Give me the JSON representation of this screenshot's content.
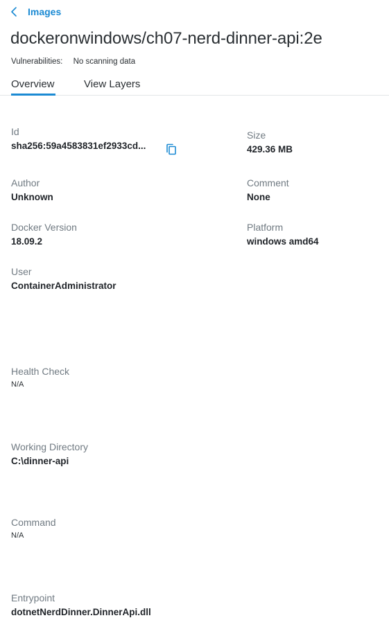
{
  "nav": {
    "back_label": "Images"
  },
  "header": {
    "title": "dockeronwindows/ch07-nerd-dinner-api:2e",
    "vulnerabilities_label": "Vulnerabilities:",
    "vulnerabilities_value": "No scanning data"
  },
  "tabs": [
    {
      "label": "Overview",
      "active": true
    },
    {
      "label": "View Layers",
      "active": false
    }
  ],
  "details": {
    "id": {
      "label": "Id",
      "value": "sha256:59a4583831ef2933cd..."
    },
    "size": {
      "label": "Size",
      "value": "429.36 MB"
    },
    "author": {
      "label": "Author",
      "value": "Unknown"
    },
    "comment": {
      "label": "Comment",
      "value": "None"
    },
    "docker_version": {
      "label": "Docker Version",
      "value": "18.09.2"
    },
    "platform": {
      "label": "Platform",
      "value": "windows amd64"
    },
    "user": {
      "label": "User",
      "value": "ContainerAdministrator"
    },
    "health_check": {
      "label": "Health Check",
      "value": "N/A"
    },
    "working_directory": {
      "label": "Working Directory",
      "value": "C:\\dinner-api"
    },
    "command": {
      "label": "Command",
      "value": "N/A"
    },
    "entrypoint": {
      "label": "Entrypoint",
      "value": "dotnetNerdDinner.DinnerApi.dll"
    }
  },
  "icons": {
    "back": "chevron-left-icon",
    "copy": "copy-icon"
  },
  "colors": {
    "accent": "#1b8ad3",
    "label": "#707a82",
    "text": "#1f2328",
    "divider": "#e3e6e8"
  }
}
